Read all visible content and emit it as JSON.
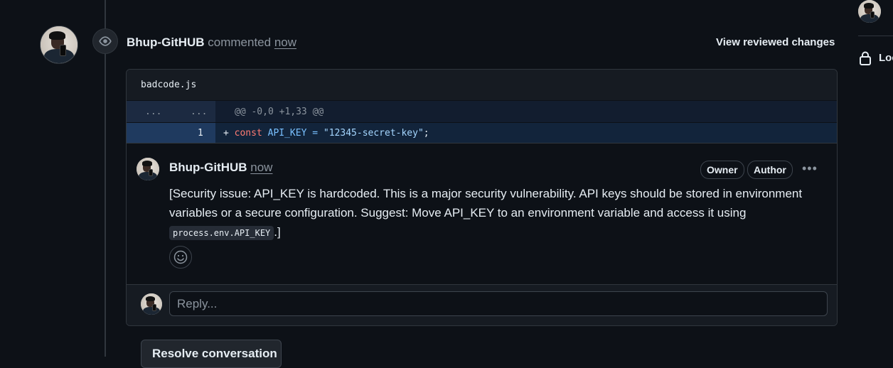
{
  "review": {
    "author": "Bhup-GitHUB",
    "action": "commented",
    "time": "now",
    "view_changes_label": "View reviewed changes"
  },
  "sidebar": {
    "lock_label": "Loc"
  },
  "file": {
    "name": "badcode.js",
    "hunk_left": "...",
    "hunk_right": "...",
    "hunk_header": "@@ -0,0 +1,33 @@",
    "line_number": "1",
    "line_marker": "+",
    "code_keyword": "const",
    "code_var": "API_KEY",
    "code_eq": " = ",
    "code_string": "\"12345-secret-key\"",
    "code_end": ";"
  },
  "comment": {
    "author": "Bhup-GitHUB",
    "time": "now",
    "owner_badge": "Owner",
    "author_badge": "Author",
    "body_text": "[Security issue: API_KEY is hardcoded. This is a major security vulnerability. API keys should be stored in environment variables or a secure configuration. Suggest: Move API_KEY to an environment variable and access it using ",
    "body_code": "process.env.API_KEY",
    "body_end": ".]"
  },
  "reply": {
    "placeholder": "Reply..."
  },
  "resolve_label": "Resolve conversation",
  "colors": {
    "background": "#0d1117",
    "added_line": "#12243b",
    "keyword": "#ff7b72",
    "variable": "#79c0ff",
    "string": "#a5d6ff"
  }
}
